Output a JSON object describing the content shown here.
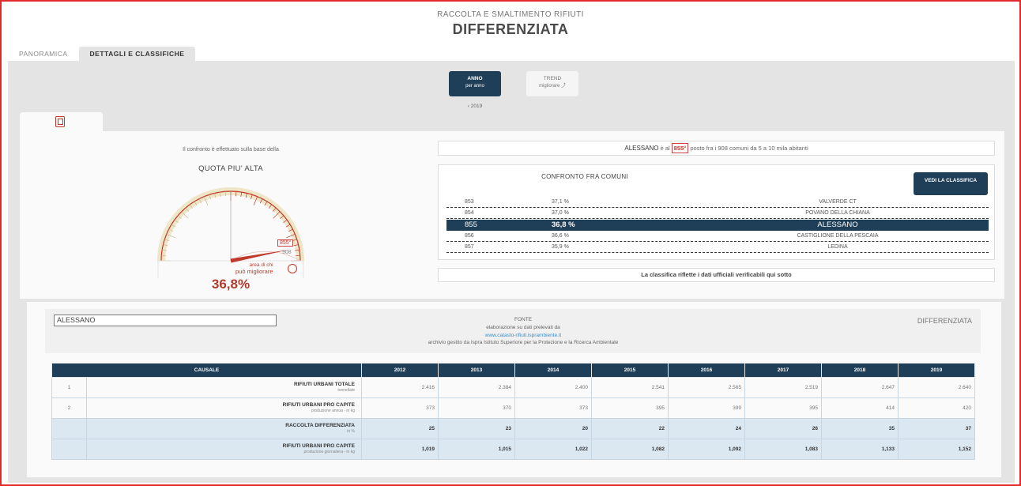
{
  "header": {
    "subtitle": "RACCOLTA E SMALTIMENTO RIFIUTI",
    "title": "DIFFERENZIATA"
  },
  "tabs": [
    {
      "label": "PANORAMICA"
    },
    {
      "label": "DETTAGLI E CLASSIFICHE"
    }
  ],
  "mode": {
    "anno": {
      "label": "ANNO",
      "sub": "per anno"
    },
    "trend": {
      "label": "TREND",
      "sub": "migliorare"
    },
    "year": "‹ 2019"
  },
  "gauge": {
    "note": "Il confronto è effettuato sulla base della",
    "title": "QUOTA PIU' ALTA",
    "position": "855°",
    "total": "908",
    "better_line1": "area di chi",
    "better_line2": "può migliorare",
    "fill_fraction": 0.94,
    "value": "36,8%"
  },
  "rank": {
    "comune": "ALESSANO",
    "pre": " è al ",
    "position": "855°",
    "post": " posto fra i 908 comuni da 5 a 10 mila abitanti"
  },
  "confronto": {
    "title": "CONFRONTO FRA COMUNI",
    "button": "VEDI LA CLASSIFICA",
    "rows": [
      {
        "pos": "853",
        "val": "37,1 %",
        "name": "VALVERDE CT"
      },
      {
        "pos": "854",
        "val": "37,0 %",
        "name": "POVANO DELLA CHIANA"
      },
      {
        "pos": "855",
        "val": "36,8 %",
        "name": "ALESSANO"
      },
      {
        "pos": "856",
        "val": "36,6 %",
        "name": "CASTIGLIONE DELLA PESCAIA"
      },
      {
        "pos": "857",
        "val": "35,9 %",
        "name": "LEDINA"
      }
    ]
  },
  "classifica_note": "La classifica riflette i dati ufficiali verificabili qui sotto",
  "source": {
    "comune": "ALESSANO",
    "fonte": "FONTE",
    "line1": "elaborazione su dati prelevati da",
    "link": "www.catasto-rifiuti.isprambiente.it",
    "line2": "archivio gestito da Ispra Istituto Superiore per la Protezione e la Ricerca Ambientale",
    "category": "DIFFERENZIATA"
  },
  "table": {
    "headers": [
      "CAUSALE",
      "2012",
      "2013",
      "2014",
      "2015",
      "2016",
      "2017",
      "2018",
      "2019"
    ],
    "rows": [
      {
        "n": "1",
        "label": "RIFIUTI URBANI TOTALE",
        "sub": "tonnellate",
        "values": [
          "2.416",
          "2.384",
          "2.400",
          "2.541",
          "2.565",
          "2.519",
          "2.647",
          "2.640"
        ]
      },
      {
        "n": "2",
        "label": "RIFIUTI URBANI PRO CAPITE",
        "sub": "produzione annua - in kg",
        "values": [
          "373",
          "370",
          "373",
          "395",
          "399",
          "395",
          "414",
          "420"
        ]
      },
      {
        "n": "",
        "label": "RACCOLTA DIFFERENZIATA",
        "sub": "in %",
        "values": [
          "25",
          "23",
          "20",
          "22",
          "24",
          "26",
          "35",
          "37"
        ]
      },
      {
        "n": "",
        "label": "RIFIUTI URBANI PRO CAPITE",
        "sub": "produzione giornaliera - in kg",
        "values": [
          "1,019",
          "1,015",
          "1,022",
          "1,082",
          "1,092",
          "1,083",
          "1,133",
          "1,152"
        ]
      }
    ]
  }
}
